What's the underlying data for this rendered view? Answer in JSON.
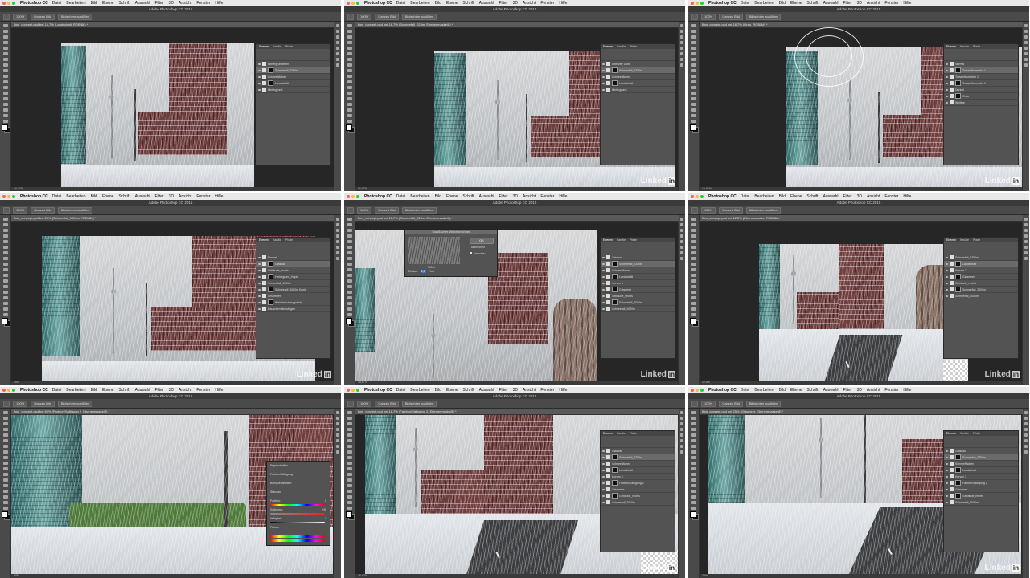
{
  "app": {
    "name": "Photoshop CC",
    "window_title": "Adobe Photoshop CC 2015",
    "menu": [
      "Datei",
      "Bearbeiten",
      "Bild",
      "Ebene",
      "Schrift",
      "Auswahl",
      "Filter",
      "3D",
      "Ansicht",
      "Fenster",
      "Hilfe"
    ]
  },
  "options_bar": {
    "buttons": [
      "100%",
      "Ganzes Bild",
      "Bildschirm ausfüllen"
    ]
  },
  "panels": {
    "tabs": [
      "Ebenen",
      "Kanäle",
      "Pfade"
    ]
  },
  "watermark": {
    "brand": "Linked",
    "badge": "in"
  },
  "colors": {
    "window_bg": "#323232",
    "panel_bg": "#535353",
    "menubar_bg": "#e8e8e8",
    "traffic_red": "#fc5f57",
    "traffic_yellow": "#fdbc2e",
    "traffic_green": "#28c840"
  },
  "screens": [
    {
      "doc_tab": "flow_concept.psd bei 16,7% (Landschaft, RGB/8#) *",
      "status": "16,67%",
      "layers": [
        "Hintergrundeben",
        "Schneefall_2250m",
        "Schneeflächen",
        "Landschaft",
        "Hintergrund"
      ]
    },
    {
      "doc_tab": "flow_concept.psd bei 16,7% (Schneefall_225m, Ebenenmaske/8) *",
      "status": "16,67%",
      "layers": [
        "Lineaher Licht",
        "Schneefall_2250m",
        "Schneeflächen",
        "Landschaft",
        "Hintergrund"
      ]
    },
    {
      "doc_tab": "flow_concept.psd bei 16,7% (Grau, RGB/8#) *",
      "status": "16,67%",
      "layers": [
        "Normal",
        "Tonwertkorrektur 1",
        "Tonwertkorrektur 1",
        "Tonwertkorrektur 1",
        "Dunkel",
        "Grau",
        "Weitere"
      ]
    },
    {
      "doc_tab": "flow_concept.psd bei 25% (Schneefall_1000m, RGB/8#) *",
      "status": "25%",
      "layers": [
        "Normal",
        "Glasbau",
        "Gebäude_rechts",
        "Hintergrund_Kopie",
        "Schneefall_1000m",
        "Schneefall_1000m Kopie",
        "Smartfilter",
        "Weichzeichnergalerie",
        "Rauschen hinzufügen"
      ]
    },
    {
      "doc_tab": "flow_concept.psd bei 16,7% (Schneefall_225m, Ebenenmaske/8) *",
      "status": "16,67%",
      "dialog": {
        "title": "Gaußscher Weichzeichner",
        "ok": "OK",
        "cancel": "Abbrechen",
        "preview_label": "Vorschau",
        "zoom": "100%",
        "radius_label": "Radius:",
        "radius_value": "2,5",
        "unit": "Pixel"
      },
      "layers": [
        "Glasbau",
        "Schneefall_2250m",
        "Schneeflächen",
        "Landschaft",
        "Kurven 1",
        "Glasmeer",
        "Gebäude_rechts",
        "Schneefall_2000m",
        "Schneefall_1000m"
      ]
    },
    {
      "doc_tab": "flow_concept.psd bei 12,5% (Ebenenmaske, RGB/8#) *",
      "status": "12,5%",
      "layers": [
        "Schneefall_2250m",
        "Landschaft",
        "Kurven 1",
        "Glasmeer",
        "Gebäude_rechts",
        "Schneefall_2000m",
        "Schneefall_1000m"
      ]
    },
    {
      "doc_tab": "flow_concept.psd bei 50% (Farbton/Sättigung 2, Ebenenmaske/8) *",
      "status": "50%",
      "properties": {
        "title": "Eigenschaften",
        "subtitle": "Farbton/Sättigung",
        "preset_label": "Vorgabe:",
        "preset_value": "Benutzerdefiniert",
        "channel": "Standard",
        "hue_label": "Farbton:",
        "hue_value": "0",
        "saturation_label": "Sättigung:",
        "saturation_value": "+30",
        "lightness_label": "Helligkeit:",
        "lightness_value": "0",
        "colorize": "Färben"
      }
    },
    {
      "doc_tab": "flow_concept.psd bei 16,7% (Farbton/Sättigung 2, Ebenenmaske/8) *",
      "status": "16,67%",
      "layers": [
        "Glasbau",
        "Schneefall_2250m",
        "Schneeflächen",
        "Landschaft",
        "Kurven 1",
        "Farbton/Sättigung 2",
        "Glasmeer",
        "Gebäude_rechts",
        "Schneefall_2000m"
      ]
    },
    {
      "doc_tab": "flow_concept.psd bei 25% (Glasmeer, Ebenenmaske/8) *",
      "status": "25%",
      "layers": [
        "Glasbau",
        "Schneefall_2250m",
        "Schneeflächen",
        "Landschaft",
        "Kurven 1",
        "Farbton/Sättigung 2",
        "Glasmeer",
        "Gebäude_rechts",
        "Schneefall_2000m"
      ]
    }
  ]
}
